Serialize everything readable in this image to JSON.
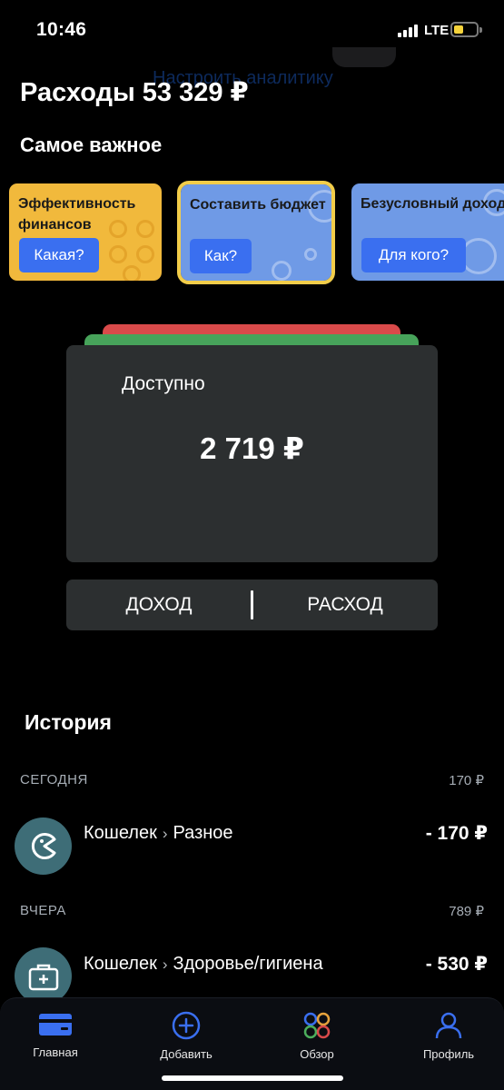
{
  "status_bar": {
    "time": "10:46",
    "network": "LTE"
  },
  "header": {
    "ghost_text": "Настроить аналитику",
    "title": "Расходы 53 329 ₽",
    "section": "Самое важное"
  },
  "cards": [
    {
      "title": "Эффективность финансов",
      "button": "Какая?",
      "color": "#f1b93c"
    },
    {
      "title": "Составить бюджет",
      "button": "Как?",
      "color": "#6f9ae6",
      "highlight": "#f2cd4a"
    },
    {
      "title": "Безусловный доход",
      "button": "Для кого?",
      "color": "#6f9ae6"
    }
  ],
  "wallet": {
    "label": "Доступно",
    "amount": "2 719 ₽",
    "stack_colors": [
      "#d94a4a",
      "#47a35a"
    ]
  },
  "switch": {
    "income": "ДОХОД",
    "expense": "РАСХОД"
  },
  "history": {
    "title": "История",
    "groups": [
      {
        "day": "СЕГОДНЯ",
        "total": "170 ₽",
        "items": [
          {
            "account": "Кошелек",
            "category": "Разное",
            "amount": "- 170 ₽",
            "icon": "pacman-icon"
          }
        ]
      },
      {
        "day": "ВЧЕРА",
        "total": "789 ₽",
        "items": [
          {
            "account": "Кошелек",
            "category": "Здоровье/гигиена",
            "amount": "- 530 ₽",
            "icon": "first-aid-kit-icon"
          }
        ]
      }
    ]
  },
  "tabbar": {
    "items": [
      {
        "label": "Главная",
        "icon": "card-icon"
      },
      {
        "label": "Добавить",
        "icon": "plus-circle-icon"
      },
      {
        "label": "Обзор",
        "icon": "circles-icon"
      },
      {
        "label": "Профиль",
        "icon": "person-icon"
      }
    ],
    "accent": "#3a6ff0"
  }
}
